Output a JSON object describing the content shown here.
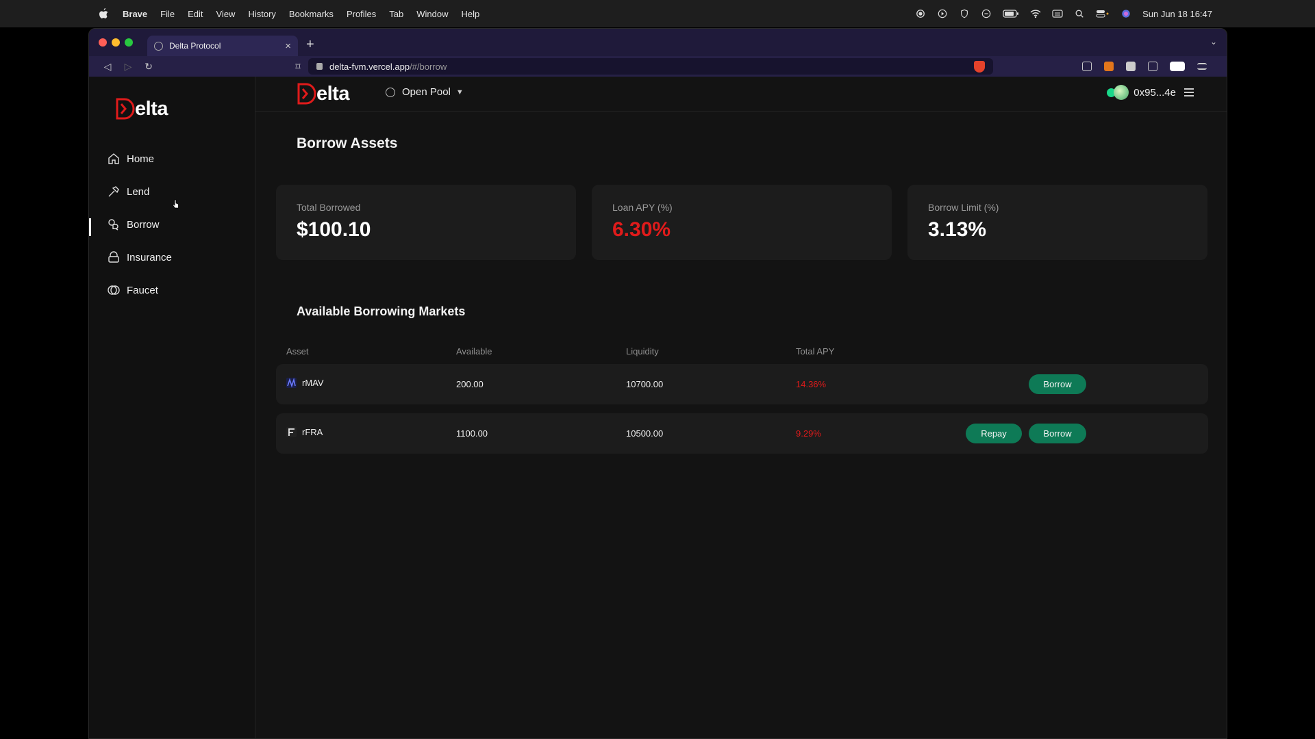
{
  "menubar": {
    "app": "Brave",
    "items": [
      "File",
      "Edit",
      "View",
      "History",
      "Bookmarks",
      "Profiles",
      "Tab",
      "Window",
      "Help"
    ],
    "clock": "Sun Jun 18  16:47"
  },
  "browser": {
    "tab_title": "Delta Protocol",
    "url_host": "delta-fvm.vercel.app",
    "url_path": "/#/borrow"
  },
  "brand": {
    "logo_text": "elta",
    "accent": "#e01b1b"
  },
  "sidebar": {
    "items": [
      {
        "label": "Home",
        "icon": "home-icon"
      },
      {
        "label": "Lend",
        "icon": "hammer-icon"
      },
      {
        "label": "Borrow",
        "icon": "borrow-icon"
      },
      {
        "label": "Insurance",
        "icon": "lock-icon"
      },
      {
        "label": "Faucet",
        "icon": "coins-icon"
      }
    ],
    "active": "Borrow"
  },
  "topbar": {
    "pool_label": "Open Pool",
    "wallet_address": "0x95...4e"
  },
  "page": {
    "title": "Borrow Assets",
    "stats": [
      {
        "label": "Total Borrowed",
        "value": "$100.10"
      },
      {
        "label": "Loan APY (%)",
        "value": "6.30%"
      },
      {
        "label": "Borrow Limit (%)",
        "value": "3.13%"
      }
    ],
    "markets_title": "Available Borrowing Markets",
    "columns": [
      "Asset",
      "Available",
      "Liquidity",
      "Total APY"
    ],
    "rows": [
      {
        "asset": "rMAV",
        "available": "200.00",
        "liquidity": "10700.00",
        "apy": "14.36%",
        "actions": [
          "Borrow"
        ]
      },
      {
        "asset": "rFRA",
        "available": "1100.00",
        "liquidity": "10500.00",
        "apy": "9.29%",
        "actions": [
          "Repay",
          "Borrow"
        ]
      }
    ]
  }
}
